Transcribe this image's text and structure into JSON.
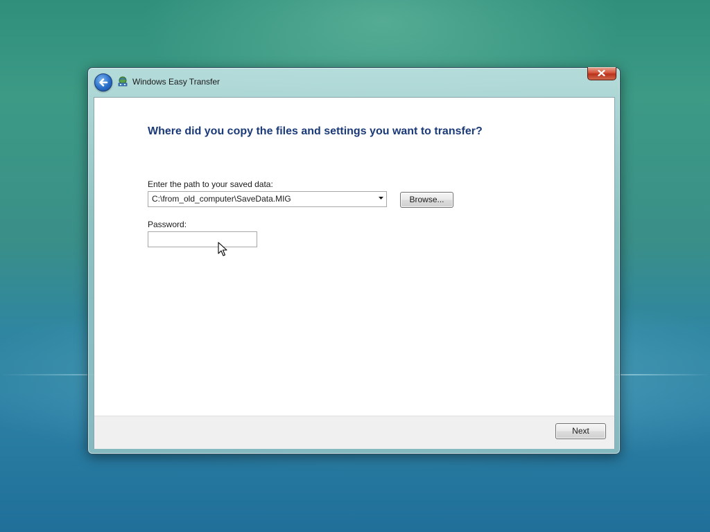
{
  "window": {
    "title": "Windows Easy Transfer",
    "close_icon": "close-icon",
    "back_icon": "back-arrow-icon",
    "app_icon": "easy-transfer-icon"
  },
  "main": {
    "heading": "Where did you copy the files and settings you want to transfer?",
    "path_label": "Enter the path to your saved data:",
    "path_value": "C:\\from_old_computer\\SaveData.MIG",
    "browse_label": "Browse...",
    "password_label": "Password:",
    "password_value": ""
  },
  "footer": {
    "next_label": "Next"
  },
  "colors": {
    "heading": "#1b3a78",
    "close_button": "#c8432a",
    "back_button": "#2a6fc9"
  }
}
